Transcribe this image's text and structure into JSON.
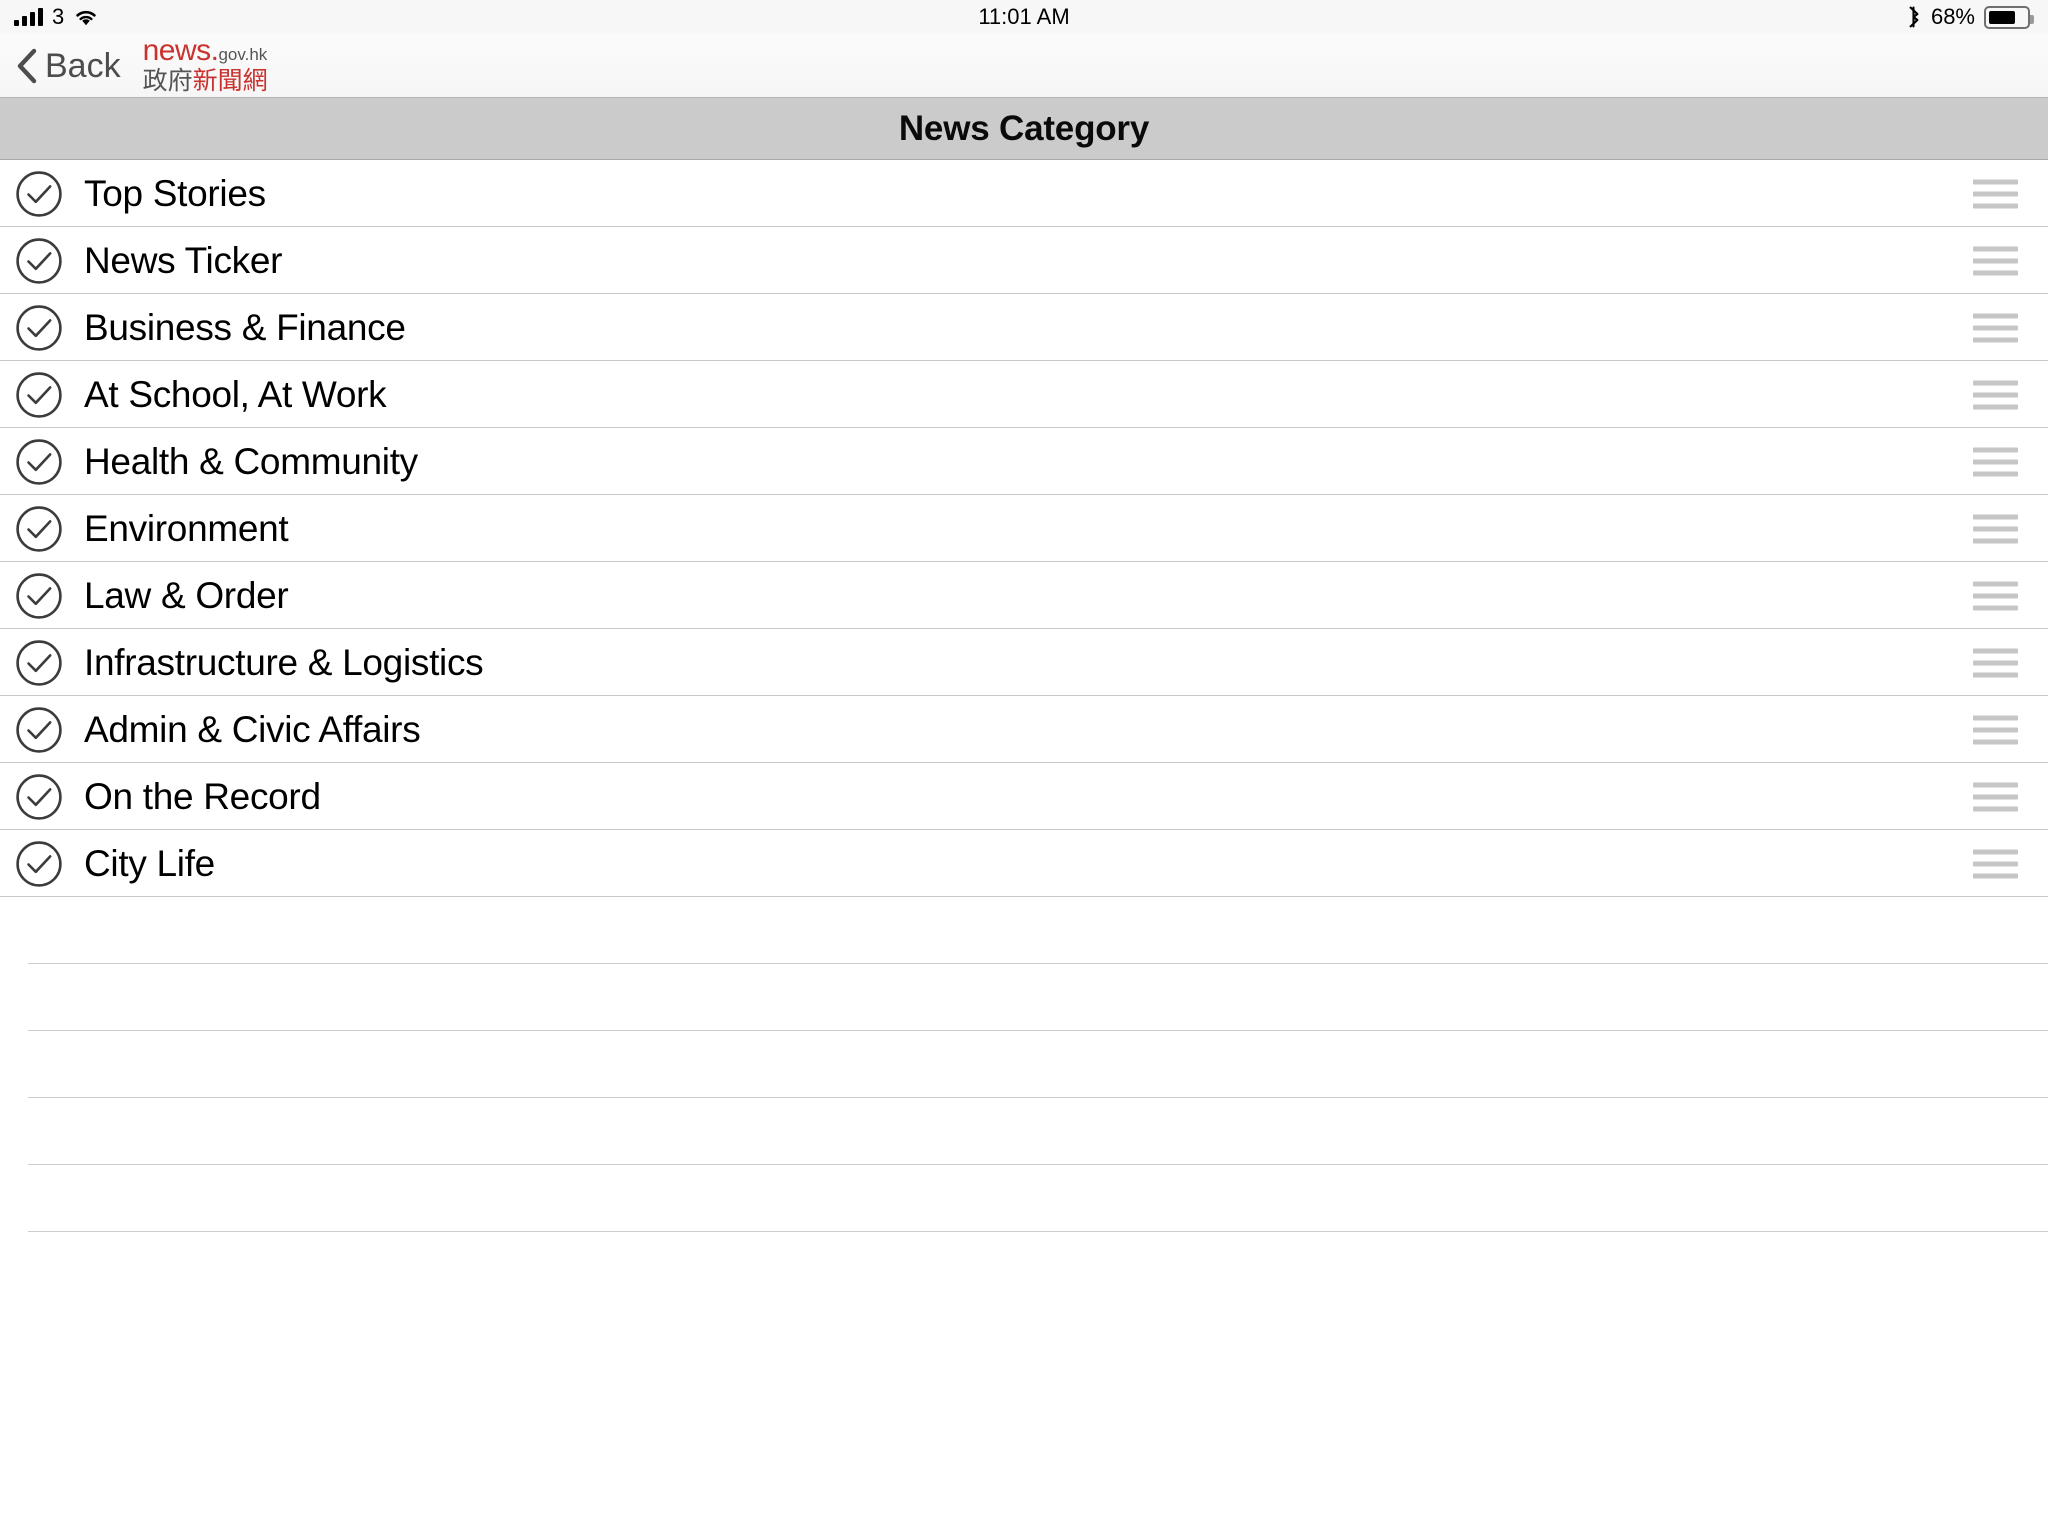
{
  "status_bar": {
    "signal_icon": "cellular-signal-icon",
    "carrier": "3",
    "wifi_icon": "wifi-icon",
    "time": "11:01 AM",
    "bluetooth_icon": "bluetooth-icon",
    "battery_percent": "68%",
    "battery_level": 68,
    "battery_icon": "battery-icon"
  },
  "nav_bar": {
    "back_icon": "chevron-left-icon",
    "back_label": "Back",
    "brand": {
      "name": "news.",
      "domain": "gov.hk",
      "chinese_dark": "政府",
      "chinese_red": "新聞網",
      "brand_color": "#c9332f",
      "text_color": "#555555"
    }
  },
  "section": {
    "title": "News Category",
    "background_color": "#cbcbcb"
  },
  "list": {
    "check_icon": "check-circle-icon",
    "handle_icon": "reorder-handle-icon",
    "items": [
      {
        "label": "Top Stories",
        "checked": true
      },
      {
        "label": "News Ticker",
        "checked": true
      },
      {
        "label": "Business & Finance",
        "checked": true
      },
      {
        "label": "At School, At Work",
        "checked": true
      },
      {
        "label": "Health & Community",
        "checked": true
      },
      {
        "label": "Environment",
        "checked": true
      },
      {
        "label": "Law & Order",
        "checked": true
      },
      {
        "label": "Infrastructure & Logistics",
        "checked": true
      },
      {
        "label": "Admin & Civic Affairs",
        "checked": true
      },
      {
        "label": "On the Record",
        "checked": true
      },
      {
        "label": "City Life",
        "checked": true
      }
    ],
    "empty_row_count": 5
  }
}
